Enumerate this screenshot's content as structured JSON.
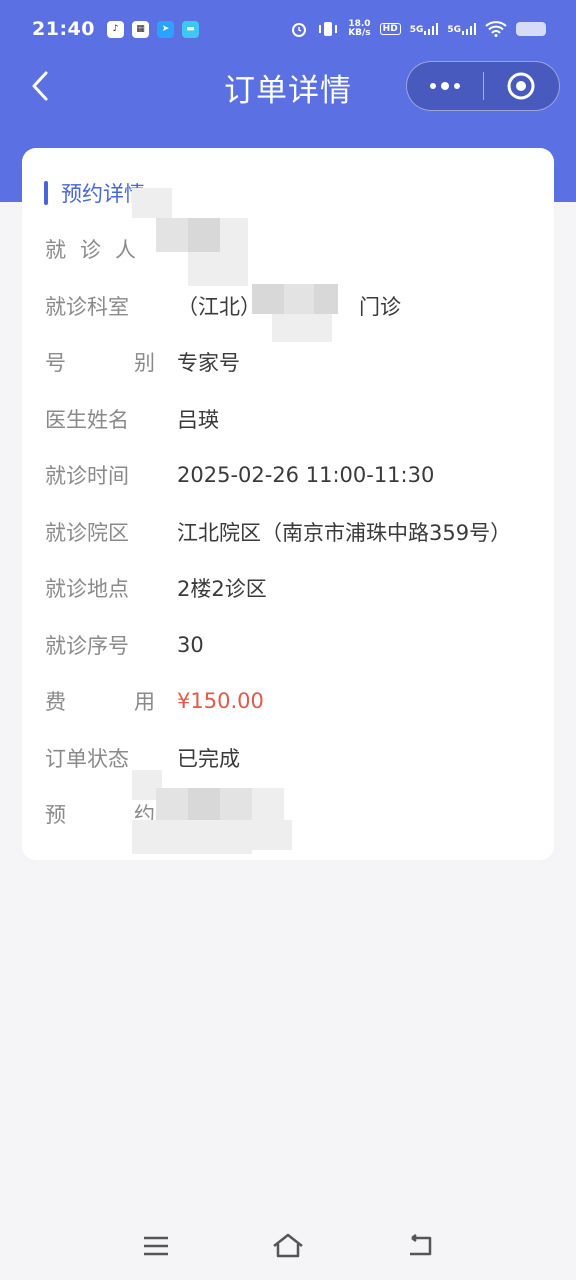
{
  "status_bar": {
    "time": "21:40",
    "network_speed_value": "18.0",
    "network_speed_unit": "KB/s",
    "signal_1": "5G",
    "signal_2": "5G",
    "hd_label": "HD"
  },
  "nav": {
    "title": "订单详情",
    "back_icon": "chevron-left-icon",
    "more_icon": "more-dots-icon",
    "close_icon": "target-circle-icon"
  },
  "section": {
    "title": "预约详情"
  },
  "details": [
    {
      "label": "就 诊 人",
      "value": ""
    },
    {
      "label": "就诊科室",
      "value": "（江北）",
      "value_suffix": "门诊"
    },
    {
      "label": "号 别",
      "value": "专家号"
    },
    {
      "label": "医生姓名",
      "value": "吕瑛"
    },
    {
      "label": "就诊时间",
      "value": "2025-02-26 11:00-11:30"
    },
    {
      "label": "就诊院区",
      "value": "江北院区（南京市浦珠中路359号）"
    },
    {
      "label": "就诊地点",
      "value": "2楼2诊区"
    },
    {
      "label": "就诊序号",
      "value": "30"
    },
    {
      "label": "费 用",
      "value": "¥150.00"
    },
    {
      "label": "订单状态",
      "value": "已完成"
    },
    {
      "label": "预 约",
      "value": ""
    }
  ],
  "colors": {
    "header": "#5b70e3",
    "accent": "#4a64dc",
    "price": "#e25a4a",
    "label": "#8a8a8a",
    "value": "#3a3a3a"
  },
  "bottom_nav": {
    "menu_icon": "menu-lines-icon",
    "home_icon": "home-icon",
    "back_icon": "back-return-icon"
  }
}
